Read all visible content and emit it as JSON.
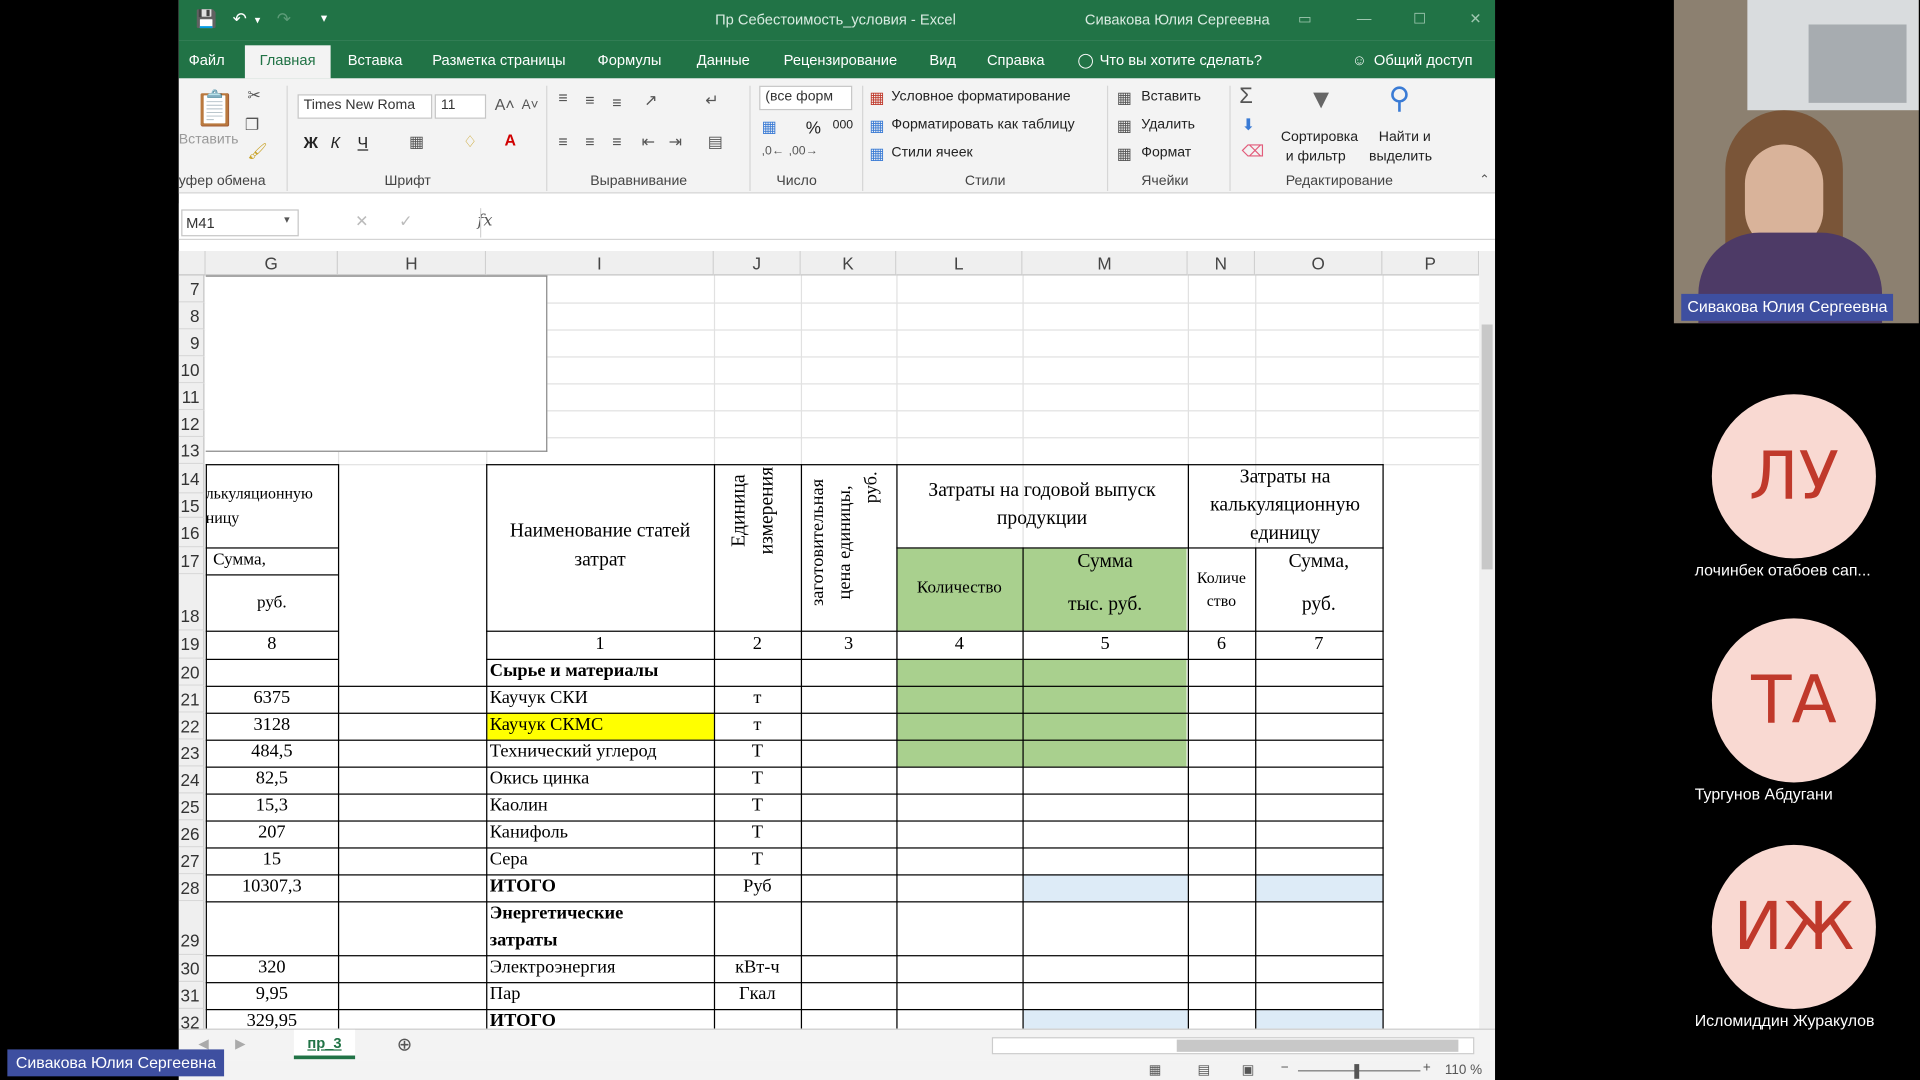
{
  "window": {
    "title": "Пр Себестоимость_условия - Excel",
    "user": "Сивакова Юлия Сергеевна"
  },
  "ribbon_tabs": [
    "Файл",
    "Главная",
    "Вставка",
    "Разметка страницы",
    "Формулы",
    "Данные",
    "Рецензирование",
    "Вид",
    "Справка"
  ],
  "tell_me": "Что вы хотите сделать?",
  "share": "Общий доступ",
  "ribbon": {
    "paste": "Вставить",
    "font_name": "Times New Roma",
    "font_size": "11",
    "bold": "Ж",
    "italic": "К",
    "underline": "Ч",
    "number_format": "(все форм",
    "percent": "%",
    "thousands": "000",
    "cond_format": "Условное форматирование",
    "format_table": "Форматировать как таблицу",
    "cell_styles": "Стили ячеек",
    "insert": "Вставить",
    "delete": "Удалить",
    "format": "Формат",
    "sort1": "Сортировка",
    "sort2": "и фильтр",
    "find1": "Найти и",
    "find2": "выделить",
    "groups": {
      "clipboard": "уфер обмена",
      "font": "Шрифт",
      "alignment": "Выравнивание",
      "number": "Число",
      "styles": "Стили",
      "cells": "Ячейки",
      "editing": "Редактирование"
    }
  },
  "formula_bar": {
    "name_box": "M41",
    "fx": "fx",
    "value": ""
  },
  "columns": [
    "G",
    "H",
    "I",
    "J",
    "K",
    "L",
    "M",
    "N",
    "O",
    "P"
  ],
  "rows": [
    "7",
    "8",
    "9",
    "10",
    "11",
    "12",
    "13",
    "14",
    "15",
    "16",
    "17",
    "18",
    "19",
    "20",
    "21",
    "22",
    "23",
    "24",
    "25",
    "26",
    "27",
    "28",
    "29",
    "30",
    "31",
    "32"
  ],
  "table": {
    "g_header1": "лькуляционную",
    "g_header2": "ницу",
    "g_sum": "Сумма,",
    "g_rub": "руб.",
    "i_header1": "Наименование статей",
    "i_header2": "затрат",
    "j_header1": "Единица",
    "j_header2": "измерения",
    "k_header1": "заготовительная",
    "k_header2": "цена единицы,",
    "k_header3": "руб.",
    "lm_header1": "Затраты на годовой выпуск",
    "lm_header2": "продукции",
    "l_qty": "Количество",
    "m_sum1": "Сумма",
    "m_sum2": "тыс. руб.",
    "no_header1": "Затраты на",
    "no_header2": "калькуляционную",
    "no_header3": "единицу",
    "n_qty1": "Количе",
    "n_qty2": "ство",
    "o_sum1": "Сумма,",
    "o_sum2": "руб.",
    "index": {
      "g": "8",
      "i": "1",
      "j": "2",
      "k": "3",
      "l": "4",
      "m": "5",
      "n": "6",
      "o": "7"
    },
    "items": [
      {
        "row": "20",
        "g": "",
        "i": "Сырье и материалы",
        "j": "",
        "bold": true
      },
      {
        "row": "21",
        "g": "6375",
        "i": "Каучук СКИ",
        "j": "т"
      },
      {
        "row": "22",
        "g": "3128",
        "i": "Каучук СКМС",
        "j": "т"
      },
      {
        "row": "23",
        "g": "484,5",
        "i": "Технический углерод",
        "j": "Т"
      },
      {
        "row": "24",
        "g": "82,5",
        "i": "Окись цинка",
        "j": "Т"
      },
      {
        "row": "25",
        "g": "15,3",
        "i": "Каолин",
        "j": "Т"
      },
      {
        "row": "26",
        "g": "207",
        "i": "Канифоль",
        "j": "Т"
      },
      {
        "row": "27",
        "g": "15",
        "i": "Сера",
        "j": "Т"
      },
      {
        "row": "28",
        "g": "10307,3",
        "i": "ИТОГО",
        "j": "Руб",
        "bold": true
      },
      {
        "row": "29",
        "g": "",
        "i": "Энергетические",
        "i2": "затраты",
        "j": "",
        "bold": true
      },
      {
        "row": "30",
        "g": "320",
        "i": "Электроэнергия",
        "j": "кВт-ч"
      },
      {
        "row": "31",
        "g": "9,95",
        "i": "Пар",
        "j": "Гкал"
      },
      {
        "row": "32",
        "g": "329,95",
        "i": "ИТОГО",
        "j": "",
        "bold": true
      }
    ]
  },
  "sheet_tab": "пр_3",
  "zoom": "110 %",
  "presenter_label": "Сивакова Юлия Сергеевна",
  "participants": [
    {
      "initials": "ЛУ",
      "name": "лочинбек отабоев сап..."
    },
    {
      "initials": "ТА",
      "name": "Тургунов Абдугани"
    },
    {
      "initials": "ИЖ",
      "name": "Исломиддин Журакулов"
    }
  ],
  "colors": {
    "excel_green": "#217346",
    "cell_green": "#a9d08e",
    "cell_yellow": "#ffff00",
    "cell_blue": "#ddebf7"
  }
}
